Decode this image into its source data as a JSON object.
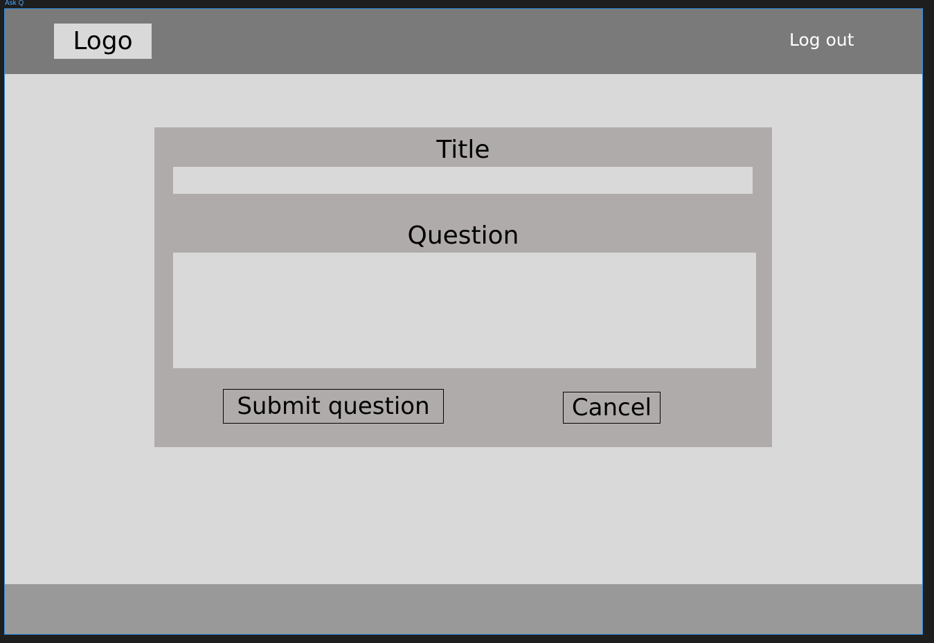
{
  "frame": {
    "label": "Ask Q"
  },
  "header": {
    "logo_text": "Logo",
    "logout_label": "Log out"
  },
  "form": {
    "title_label": "Title",
    "title_value": "",
    "question_label": "Question",
    "question_value": "",
    "submit_label": "Submit question",
    "cancel_label": "Cancel"
  },
  "colors": {
    "header_bg": "#7a7a7a",
    "page_bg": "#d9d9d9",
    "card_bg": "#b0abab",
    "footer_bg": "#999999",
    "frame_border": "#2f8fe6"
  }
}
